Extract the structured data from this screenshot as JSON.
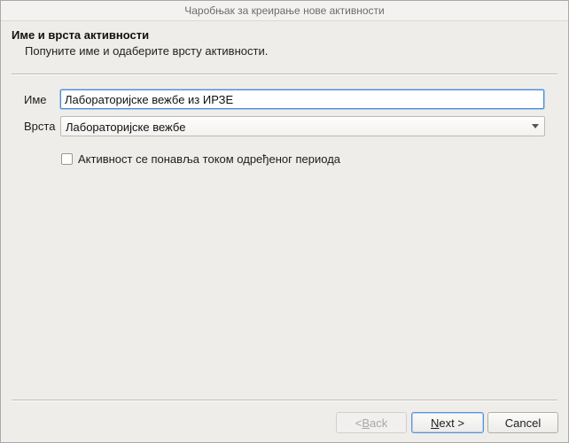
{
  "window": {
    "title": "Чаробњак за креирање нове активности"
  },
  "header": {
    "title": "Име и врста активности",
    "description": "Попуните име и одаберите врсту активности."
  },
  "form": {
    "name_label": "Име",
    "name_value": "Лабораторијске вежбе из ИРЗЕ",
    "type_label": "Врста",
    "type_value": "Лабораторијске вежбе",
    "repeat_label": "Активност се понавља током одређеног периода",
    "repeat_checked": false
  },
  "buttons": {
    "back_prefix": "< ",
    "back_mnemonic": "B",
    "back_rest": "ack",
    "next_mnemonic": "N",
    "next_rest": "ext >",
    "cancel_label": "Cancel"
  }
}
